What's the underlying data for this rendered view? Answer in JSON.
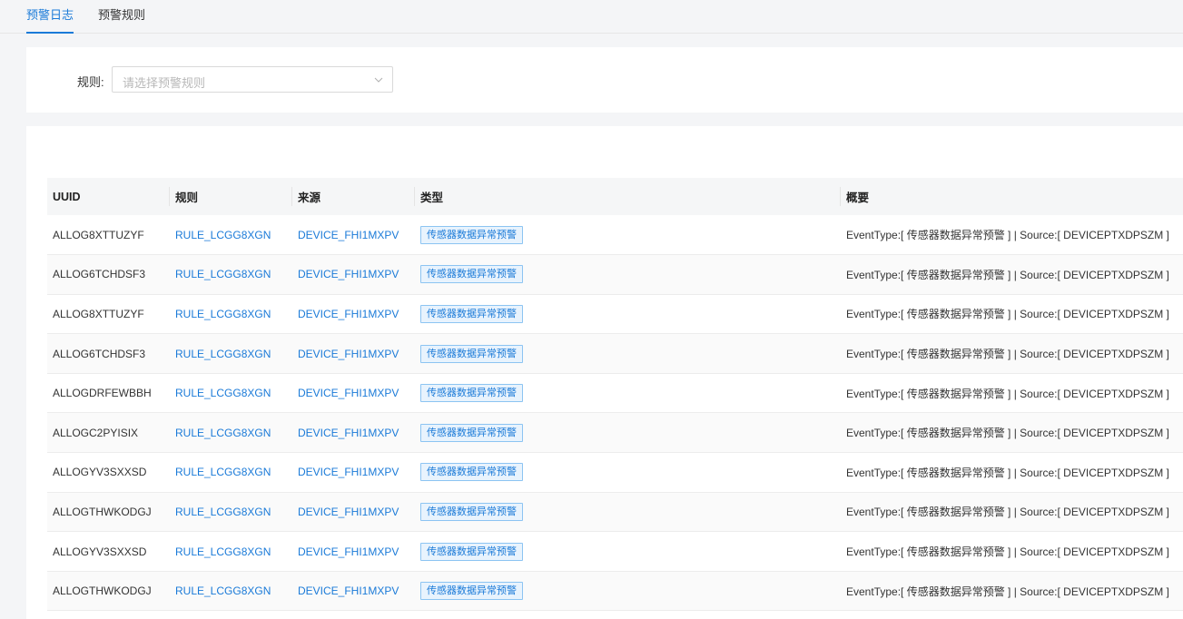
{
  "tabs": [
    {
      "label": "预警日志",
      "active": true
    },
    {
      "label": "预警规则",
      "active": false
    }
  ],
  "filter": {
    "label": "规则:",
    "placeholder": "请选择预警规则"
  },
  "table": {
    "columns": [
      "UUID",
      "规则",
      "来源",
      "类型",
      "概要"
    ],
    "rows": [
      {
        "uuid": "ALLOG8XTTUZYF",
        "rule": "RULE_LCGG8XGN",
        "source": "DEVICE_FHI1MXPV",
        "type": "传感器数据异常预警",
        "summary": "EventType:[ 传感器数据异常预警 ] | Source:[ DEVICEPTXDPSZM ]"
      },
      {
        "uuid": "ALLOG6TCHDSF3",
        "rule": "RULE_LCGG8XGN",
        "source": "DEVICE_FHI1MXPV",
        "type": "传感器数据异常预警",
        "summary": "EventType:[ 传感器数据异常预警 ] | Source:[ DEVICEPTXDPSZM ]"
      },
      {
        "uuid": "ALLOG8XTTUZYF",
        "rule": "RULE_LCGG8XGN",
        "source": "DEVICE_FHI1MXPV",
        "type": "传感器数据异常预警",
        "summary": "EventType:[ 传感器数据异常预警 ] | Source:[ DEVICEPTXDPSZM ]"
      },
      {
        "uuid": "ALLOG6TCHDSF3",
        "rule": "RULE_LCGG8XGN",
        "source": "DEVICE_FHI1MXPV",
        "type": "传感器数据异常预警",
        "summary": "EventType:[ 传感器数据异常预警 ] | Source:[ DEVICEPTXDPSZM ]"
      },
      {
        "uuid": "ALLOGDRFEWBBH",
        "rule": "RULE_LCGG8XGN",
        "source": "DEVICE_FHI1MXPV",
        "type": "传感器数据异常预警",
        "summary": "EventType:[ 传感器数据异常预警 ] | Source:[ DEVICEPTXDPSZM ]"
      },
      {
        "uuid": "ALLOGC2PYISIX",
        "rule": "RULE_LCGG8XGN",
        "source": "DEVICE_FHI1MXPV",
        "type": "传感器数据异常预警",
        "summary": "EventType:[ 传感器数据异常预警 ] | Source:[ DEVICEPTXDPSZM ]"
      },
      {
        "uuid": "ALLOGYV3SXXSD",
        "rule": "RULE_LCGG8XGN",
        "source": "DEVICE_FHI1MXPV",
        "type": "传感器数据异常预警",
        "summary": "EventType:[ 传感器数据异常预警 ] | Source:[ DEVICEPTXDPSZM ]"
      },
      {
        "uuid": "ALLOGTHWKODGJ",
        "rule": "RULE_LCGG8XGN",
        "source": "DEVICE_FHI1MXPV",
        "type": "传感器数据异常预警",
        "summary": "EventType:[ 传感器数据异常预警 ] | Source:[ DEVICEPTXDPSZM ]"
      },
      {
        "uuid": "ALLOGYV3SXXSD",
        "rule": "RULE_LCGG8XGN",
        "source": "DEVICE_FHI1MXPV",
        "type": "传感器数据异常预警",
        "summary": "EventType:[ 传感器数据异常预警 ] | Source:[ DEVICEPTXDPSZM ]"
      },
      {
        "uuid": "ALLOGTHWKODGJ",
        "rule": "RULE_LCGG8XGN",
        "source": "DEVICE_FHI1MXPV",
        "type": "传感器数据异常预警",
        "summary": "EventType:[ 传感器数据异常预警 ] | Source:[ DEVICEPTXDPSZM ]"
      }
    ]
  },
  "colors": {
    "accent": "#1a7ad8",
    "badge_bg": "#e8f3fd",
    "badge_border": "#8cc4f2"
  }
}
